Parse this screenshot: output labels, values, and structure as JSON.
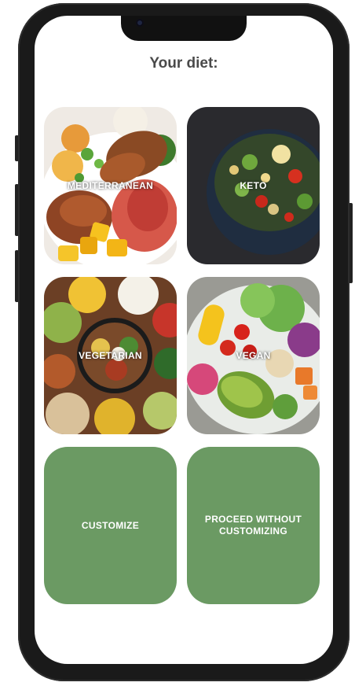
{
  "page": {
    "title": "Your diet:"
  },
  "diets": [
    {
      "label": "MEDITERRANEAN"
    },
    {
      "label": "KETO"
    },
    {
      "label": "VEGETARIAN"
    },
    {
      "label": "VEGAN"
    }
  ],
  "actions": {
    "customize_label": "CUSTOMIZE",
    "proceed_label": "PROCEED WITHOUT CUSTOMIZING"
  },
  "colors": {
    "accent": "#6b9a63",
    "title": "#4a4a4a"
  }
}
